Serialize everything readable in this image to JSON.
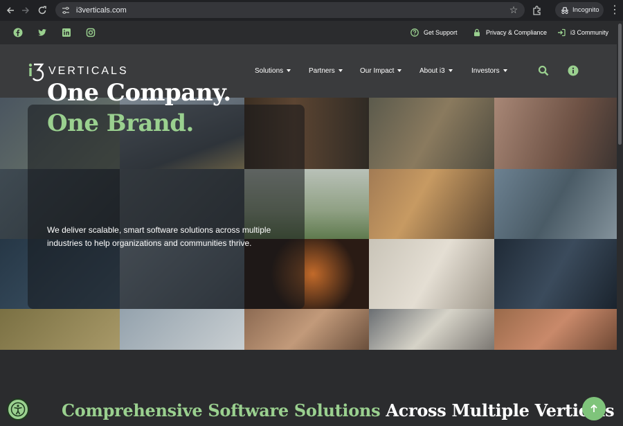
{
  "browser": {
    "url": "i3verticals.com",
    "incognito_label": "Incognito"
  },
  "utility_bar": {
    "social": [
      "facebook-icon",
      "twitter-icon",
      "linkedin-icon",
      "instagram-icon"
    ],
    "links": [
      {
        "label": "Get Support",
        "icon": "question-circle-icon"
      },
      {
        "label": "Privacy & Compliance",
        "icon": "lock-icon"
      },
      {
        "label": "i3 Community",
        "icon": "sign-in-icon"
      }
    ]
  },
  "nav": {
    "logo_mark": "i3",
    "logo_word": "VERTICALS",
    "items": [
      {
        "label": "Solutions"
      },
      {
        "label": "Partners"
      },
      {
        "label": "Our Impact"
      },
      {
        "label": "About i3"
      },
      {
        "label": "Investors"
      }
    ]
  },
  "hero": {
    "title": "One Company.",
    "subtitle": "One Brand.",
    "body": "We deliver scalable, smart software solutions across multiple industries to help organizations and communities thrive."
  },
  "section": {
    "heading_green": "Comprehensive Software Solutions",
    "heading_white": " Across Multiple Verticals"
  },
  "colors": {
    "accent": "#9ad08f",
    "page_bg": "#3a3b3d",
    "bar_bg": "#2b2c2e"
  }
}
